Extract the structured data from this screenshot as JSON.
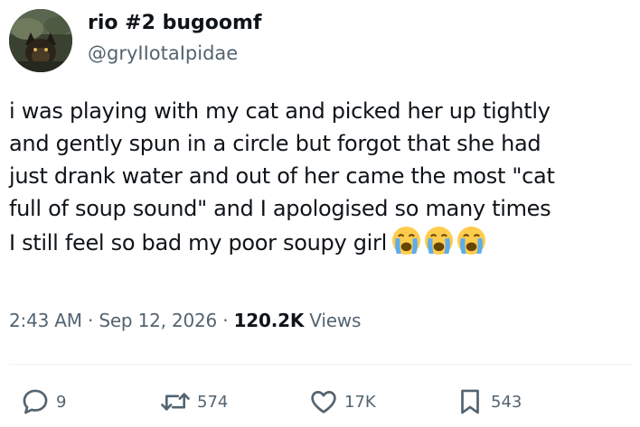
{
  "author": {
    "display_name": "rio #2 bugoomf",
    "handle": "@gryIIotaIpidae",
    "avatar_icon": "avatar-image"
  },
  "tweet": {
    "lines": [
      "i was playing with my cat and picked her up tightly",
      "and gently spun in a circle but forgot that she had",
      "just drank water and out of her came the most \"cat",
      "full of soup sound\" and I apologised so many times",
      "I still feel so bad my poor soupy girl"
    ],
    "emojis": [
      "loudly-crying-face-emoji",
      "loudly-crying-face-emoji",
      "loudly-crying-face-emoji"
    ]
  },
  "meta": {
    "time": "2:43 AM",
    "separator": "·",
    "date": "Sep 12, 2026",
    "views_count": "120.2K",
    "views_label": "Views"
  },
  "actions": {
    "reply_count": "9",
    "repost_count": "574",
    "like_count": "17K",
    "bookmark_count": "543"
  },
  "colors": {
    "text": "#0f1419",
    "secondary": "#536471",
    "divider": "#eff3f4"
  }
}
